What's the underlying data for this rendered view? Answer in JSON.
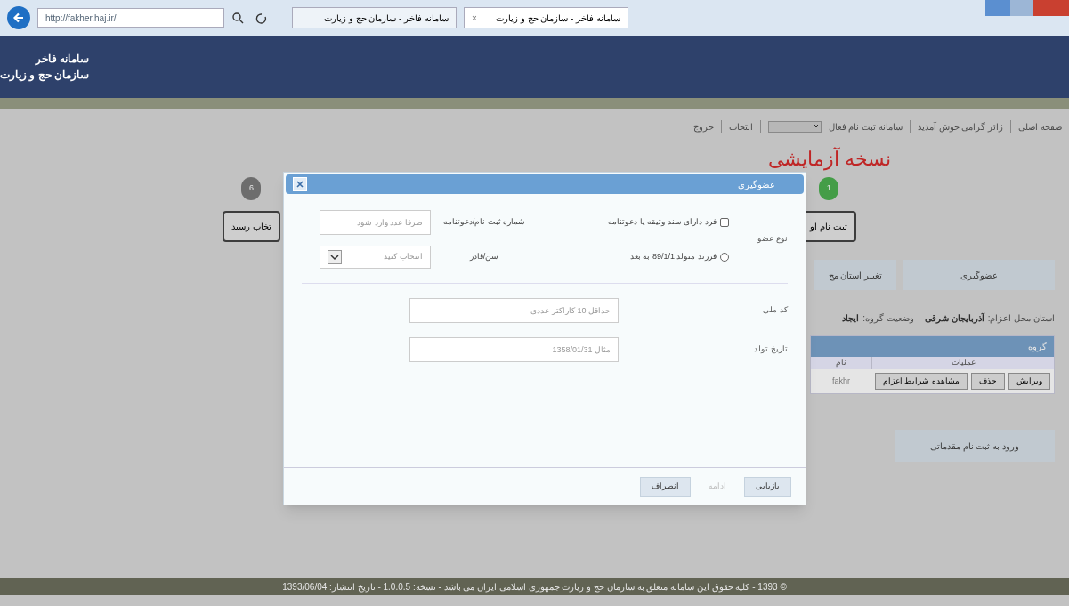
{
  "browser": {
    "address": "http://fakher.haj.ir/",
    "tabs": [
      {
        "label": "سامانه فاخر - سازمان حج و زیارت",
        "selected": true,
        "close": "×"
      },
      {
        "label": "سامانه فاخر - سازمان حج و زیارت",
        "selected": false
      }
    ]
  },
  "header": {
    "title": "سامانه فاخر",
    "subtitle": "سازمان حج و زیارت"
  },
  "nav": {
    "items": [
      {
        "kind": "link",
        "label": "صفحه اصلی"
      },
      {
        "kind": "text",
        "label": "زائر گرامی خوش آمدید"
      },
      {
        "kind": "select",
        "label": "سامانه ثبت نام فعال"
      },
      {
        "kind": "link",
        "label": "انتخاب"
      },
      {
        "kind": "link",
        "label": "خروج"
      }
    ]
  },
  "page_title": "نسخه آزمایشی",
  "steps": [
    {
      "number": "1",
      "label": "ثبت نام او",
      "color": "#4caf50"
    },
    {
      "number": "6",
      "label": "تخاب رسید",
      "color": "#7a7a7a"
    }
  ],
  "actions": [
    "عضوگیری",
    "تغییر استان مح"
  ],
  "info": [
    {
      "label": "استان محل اعزام:",
      "value": "آذربایجان شرقی"
    },
    {
      "label": "وضعیت گروه:",
      "value": "ایجاد"
    }
  ],
  "group_table": {
    "title": "گروه",
    "columns": [
      "عملیات",
      "نام"
    ],
    "rows": [
      {
        "buttons": [
          "ویرایش",
          "حذف",
          "مشاهده شرایط اعزام"
        ],
        "name": "fakhr"
      }
    ]
  },
  "continue_button": "ورود به ثبت نام مقدماتی",
  "dialog": {
    "title": "عضوگیری",
    "member_type_label": "نوع عضو",
    "options": [
      {
        "kind": "checkbox",
        "label": "فرد دارای سند وثیقه یا دعوتنامه",
        "checked": false,
        "field": {
          "kind": "input",
          "label": "شماره ثبت نام/دعوتنامه",
          "placeholder": "صرفا عدد وارد شود"
        }
      },
      {
        "kind": "radio",
        "label": "فرزند متولد 89/1/1 به بعد",
        "checked": false,
        "field": {
          "kind": "select",
          "label": "سن/قادر",
          "placeholder": "انتخاب کنید"
        }
      }
    ],
    "fields": [
      {
        "label": "کد ملی",
        "placeholder": "حداقل 10 کاراکتر عددی"
      },
      {
        "label": "تاریخ تولد",
        "placeholder": "مثال 1358/01/31"
      }
    ],
    "buttons": [
      {
        "label": "بازیابی",
        "disabled": false
      },
      {
        "label": "ادامه",
        "disabled": true
      },
      {
        "label": "انصراف",
        "disabled": false
      }
    ]
  },
  "footer": "© 1393 - کلیه حقوق این سامانه متعلق به سازمان حج و زیارت جمهوری اسلامی ایران می باشد - نسخه: 1.0.0.5 - تاریخ انتشار: 1393/06/04"
}
